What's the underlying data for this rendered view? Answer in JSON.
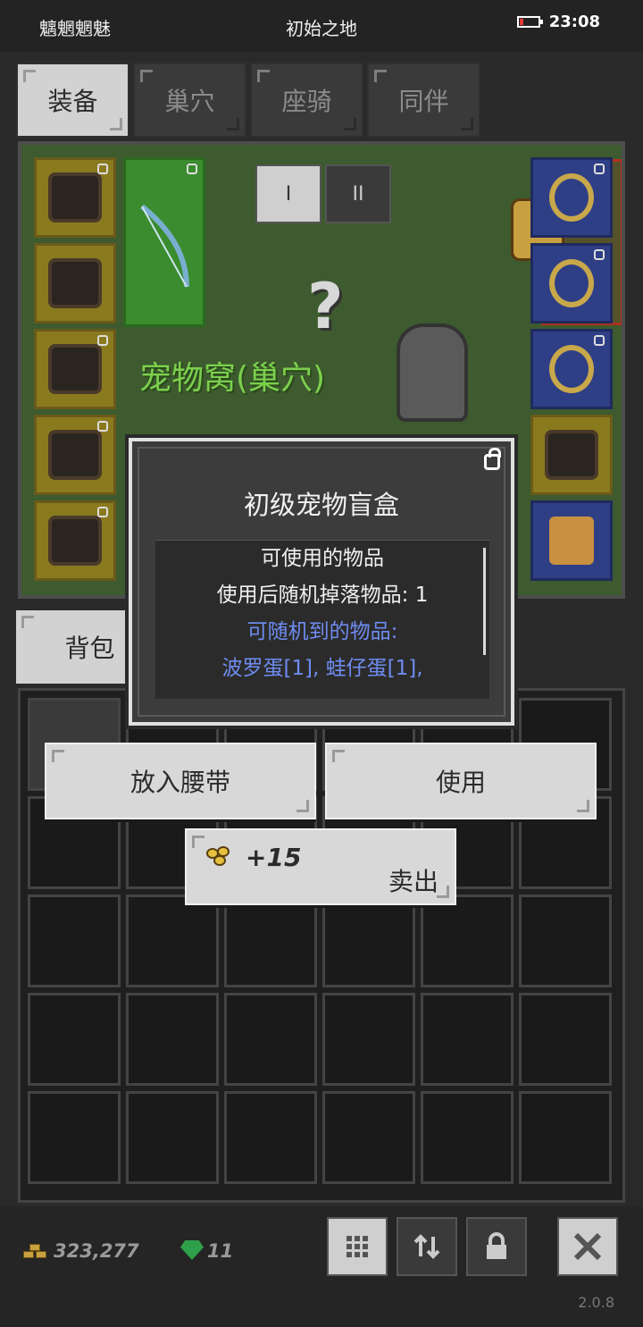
{
  "status": {
    "left": "魑魍魍魅",
    "center": "初始之地",
    "time": "23:08"
  },
  "tabs": [
    {
      "label": "装备",
      "active": true
    },
    {
      "label": "巢穴",
      "active": false
    },
    {
      "label": "座骑",
      "active": false
    },
    {
      "label": "同伴",
      "active": false
    }
  ],
  "equip": {
    "page_buttons": [
      "I",
      "II"
    ],
    "scene_label": "宠物窝(巢穴)",
    "question_mark": "?"
  },
  "bag_tab": {
    "label": "背包"
  },
  "modal": {
    "title": "初级宠物盲盒",
    "lines": [
      {
        "text": "可使用的物品",
        "color": "#f0f0f0"
      },
      {
        "text": "使用后随机掉落物品: 1",
        "color": "#f0f0f0"
      },
      {
        "text": "可随机到的物品:",
        "color": "#6e8cf0"
      },
      {
        "text": "波罗蛋[1], 蛙仔蛋[1],",
        "color": "#6e8cf0"
      }
    ]
  },
  "actions": {
    "belt_label": "放入腰带",
    "use_label": "使用",
    "sell_price": "+15",
    "sell_label": "卖出"
  },
  "footer": {
    "gold": "323,277",
    "gems": "11",
    "version": "2.0.8",
    "tools": [
      "grid-icon",
      "sort-icon",
      "lock-icon",
      "close-icon"
    ]
  },
  "colors": {
    "accent_blue": "#6e8cf0",
    "gem_green": "#2fa04a",
    "gold": "#e8c040"
  }
}
